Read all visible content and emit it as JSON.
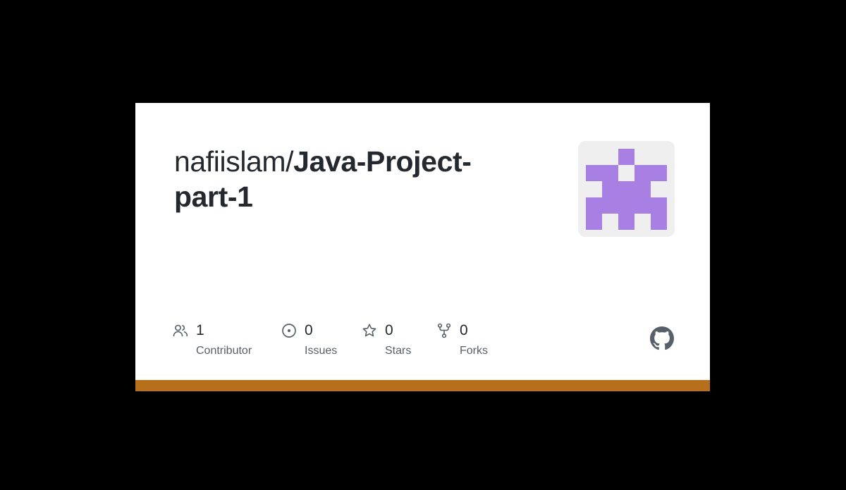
{
  "repo": {
    "owner_prefix": "nafiislam/",
    "name": "Java-Project-part-1"
  },
  "avatar": {
    "icon": "identicon",
    "color": "#a87fe3",
    "background": "#efefef"
  },
  "stats": [
    {
      "icon": "people-icon",
      "count": "1",
      "label": "Contributor"
    },
    {
      "icon": "issue-icon",
      "count": "0",
      "label": "Issues"
    },
    {
      "icon": "star-icon",
      "count": "0",
      "label": "Stars"
    },
    {
      "icon": "fork-icon",
      "count": "0",
      "label": "Forks"
    }
  ],
  "brand": {
    "logo_icon": "github-icon",
    "accent_color": "#b76f1c"
  }
}
